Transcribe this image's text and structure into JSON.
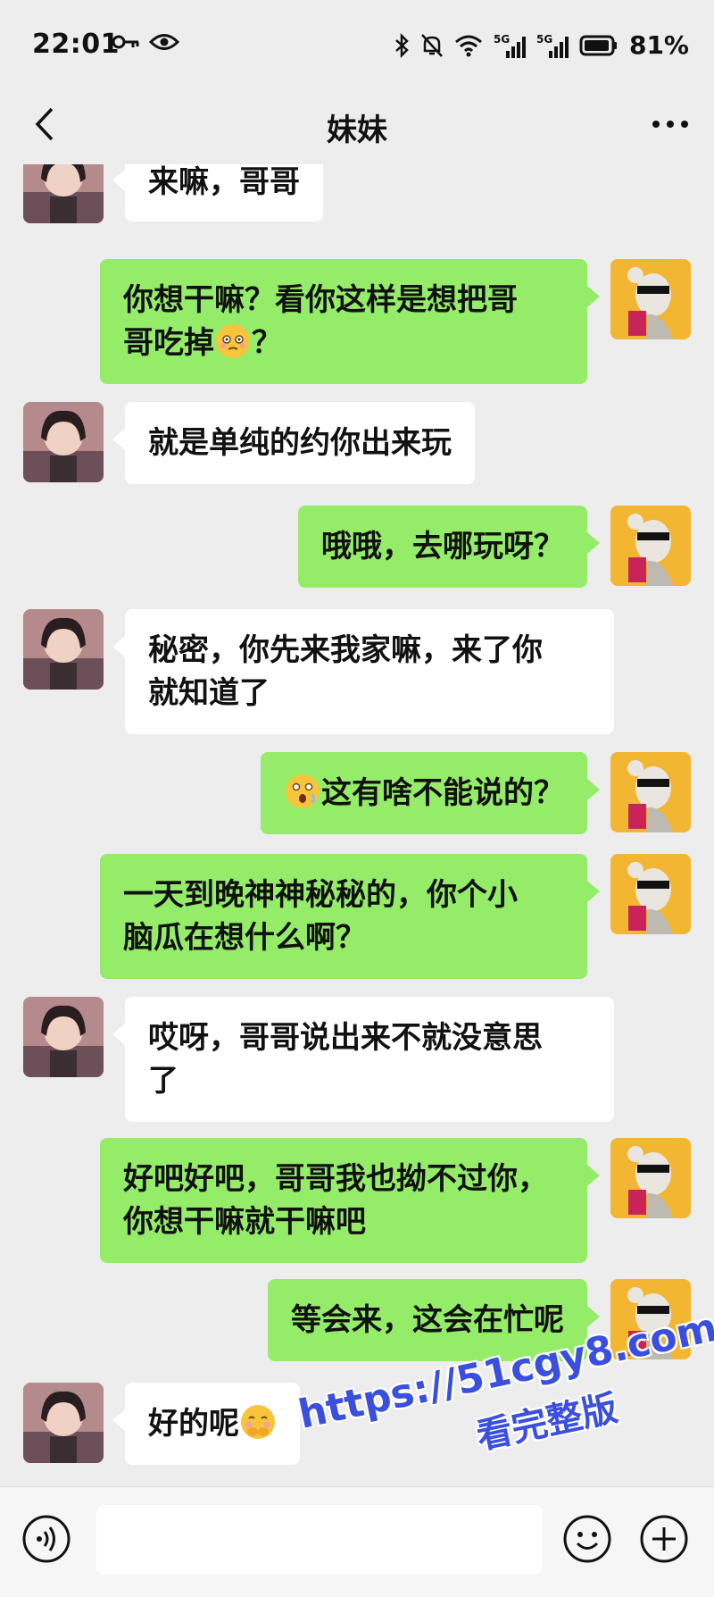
{
  "status_bar": {
    "time": "22:01",
    "network_left": "5G",
    "network_right": "5G",
    "battery": "81%"
  },
  "header": {
    "title": "妹妹"
  },
  "messages": [
    {
      "from": "contact",
      "text": "来嘛，哥哥"
    },
    {
      "from": "me",
      "line1": "你想干嘛？看你这样是想把哥",
      "line2_pre": "哥吃掉",
      "line2_post": "？"
    },
    {
      "from": "contact",
      "text": "就是单纯的约你出来玩"
    },
    {
      "from": "me",
      "text": "哦哦，去哪玩呀？"
    },
    {
      "from": "contact",
      "line1": "秘密，你先来我家嘛，来了你",
      "line2": "就知道了"
    },
    {
      "from": "me",
      "text": "这有啥不能说的？"
    },
    {
      "from": "me",
      "line1": "一天到晚神神秘秘的，你个小",
      "line2": "脑瓜在想什么啊？"
    },
    {
      "from": "contact",
      "line1": "哎呀，哥哥说出来不就没意思",
      "line2": "了"
    },
    {
      "from": "me",
      "line1": "好吧好吧，哥哥我也拗不过你，",
      "line2": "你想干嘛就干嘛吧"
    },
    {
      "from": "me",
      "text": "等会来，这会在忙呢"
    },
    {
      "from": "contact",
      "text": "好的呢"
    }
  ],
  "input": {
    "placeholder": ""
  },
  "watermark": {
    "url": "https://51cgy8.com",
    "text": "看完整版"
  },
  "colors": {
    "background": "#ededed",
    "my_bubble": "#95ec69",
    "their_bubble": "#ffffff",
    "watermark": "#3a4fe0"
  },
  "icons": [
    "key-icon",
    "eye-icon",
    "bluetooth-icon",
    "mute-icon",
    "wifi-icon",
    "signal-icon",
    "battery-icon",
    "back-icon",
    "more-icon",
    "voice-icon",
    "emoji-icon",
    "plus-icon"
  ]
}
